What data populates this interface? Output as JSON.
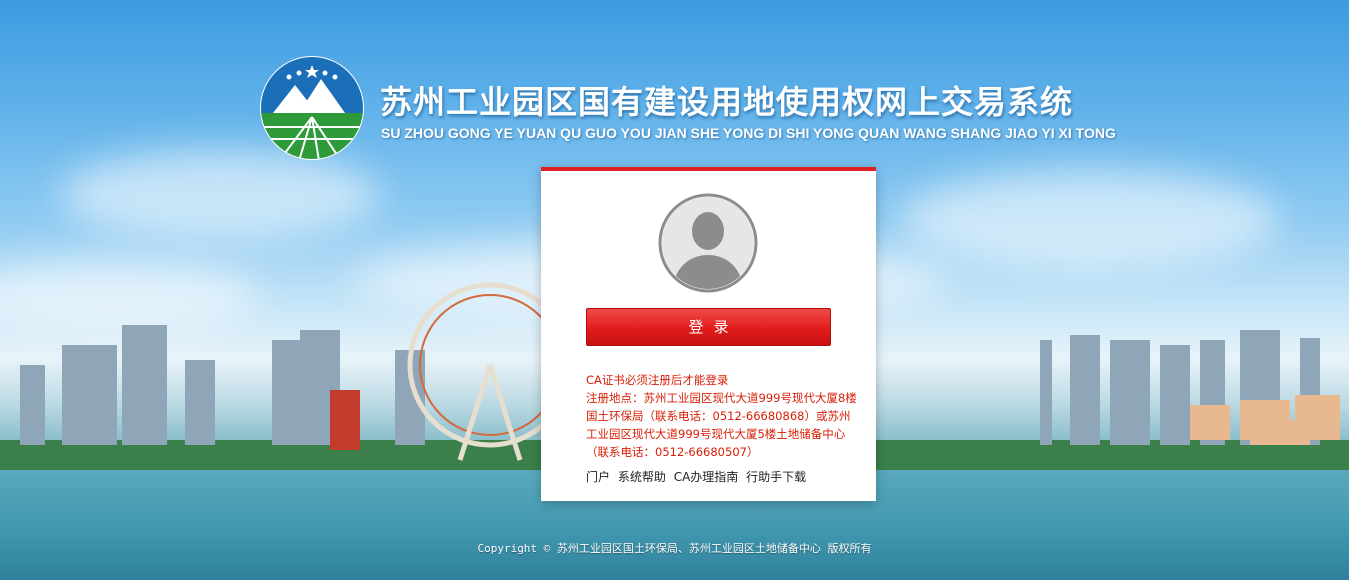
{
  "header": {
    "title_cn": "苏州工业园区国有建设用地使用权网上交易系统",
    "title_en": "SU ZHOU GONG YE YUAN QU GUO YOU JIAN SHE YONG DI SHI YONG QUAN WANG SHANG JIAO YI XI TONG"
  },
  "login": {
    "button_label": "登录",
    "notice_line1": "CA证书必须注册后才能登录",
    "notice_line2": "注册地点：苏州工业园区现代大道999号现代大厦8楼国土环保局（联系电话：0512-66680868）或苏州工业园区现代大道999号现代大厦5楼土地储备中心（联系电话：0512-66680507）"
  },
  "links": [
    {
      "label": "门户"
    },
    {
      "label": "系统帮助"
    },
    {
      "label": "CA办理指南"
    },
    {
      "label": "行助手下载"
    }
  ],
  "footer": {
    "copyright": "Copyright © 苏州工业园区国土环保局、苏州工业园区土地储备中心 版权所有"
  },
  "colors": {
    "accent": "#e02020",
    "notice_text": "#d81e06",
    "logo_green": "#2e9a3a",
    "logo_blue": "#1a6fb8"
  },
  "icons": {
    "logo": "mountain-stars-logo",
    "avatar": "user-avatar-icon"
  }
}
